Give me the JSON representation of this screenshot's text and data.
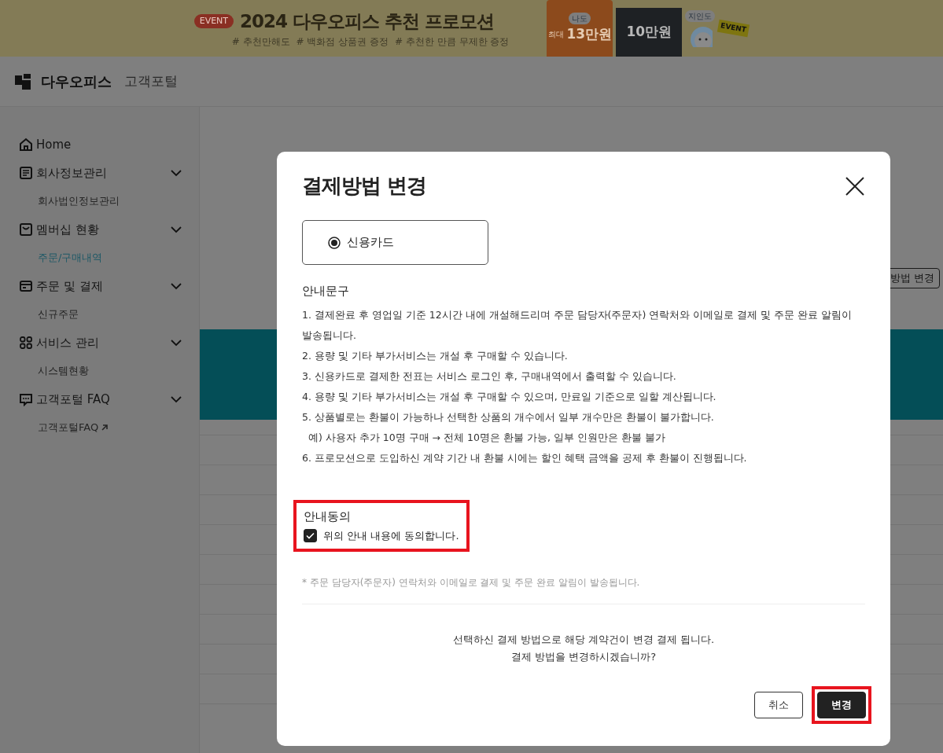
{
  "banner": {
    "badge": "EVENT",
    "title": "2024 다우오피스 추천 프로모션",
    "tags": [
      "# 추천만해도",
      "# 백화점 상품권 증정",
      "# 추천한 만큼 무제한 증정"
    ],
    "promo": {
      "tag_left": "나도",
      "card_left_prefix": "최대",
      "card_left_amount": "13만원",
      "card_right_amount": "10만원",
      "tag_right": "지인도",
      "sign": "EVENT"
    }
  },
  "header": {
    "brand": "다우오피스",
    "portal": "고객포털"
  },
  "sidebar": {
    "items": [
      {
        "label": "Home"
      },
      {
        "label": "회사정보관리",
        "children": [
          {
            "label": "회사법인정보관리",
            "selected": false
          }
        ]
      },
      {
        "label": "멤버십 현황",
        "children": [
          {
            "label": "주문/구매내역",
            "selected": true
          }
        ]
      },
      {
        "label": "주문 및 결제",
        "children": [
          {
            "label": "신규주문",
            "selected": false
          }
        ]
      },
      {
        "label": "서비스 관리",
        "children": [
          {
            "label": "시스템현황",
            "selected": false
          }
        ]
      },
      {
        "label": "고객포털 FAQ",
        "children": [
          {
            "label": "고객포털FAQ",
            "selected": false,
            "external": true
          }
        ]
      }
    ]
  },
  "main": {
    "action_button": "방법 변경"
  },
  "modal": {
    "title": "결제방법 변경",
    "payment_options": [
      {
        "label": "신용카드",
        "selected": true
      }
    ],
    "notice_heading": "안내문구",
    "notice_lines": [
      "1. 결제완료 후 영업일 기준 12시간 내에 개설해드리며 주문 담당자(주문자) 연락처와 이메일로 결제 및 주문 완료 알림이 발송됩니다.",
      "2. 용량 및 기타 부가서비스는 개설 후 구매할 수 있습니다.",
      "3. 신용카드로 결제한 전표는 서비스 로그인 후, 구매내역에서 출력할 수 있습니다.",
      "4. 용량 및 기타 부가서비스는 개설 후 구매할 수 있으며, 만료일 기준으로 일할 계산됩니다.",
      "5. 상품별로는 환불이 가능하나 선택한 상품의 개수에서 일부 개수만은 환불이 불가합니다.",
      "  예) 사용자 추가 10명 구매 → 전체 10명은 환불 가능, 일부 인원만은 환불 불가",
      "6. 프로모션으로 도입하신 계약 기간 내 환불 시에는 할인 혜택 금액을 공제 후 환불이 진행됩니다."
    ],
    "agreement": {
      "heading": "안내동의",
      "label": "위의 안내 내용에 동의합니다.",
      "checked": true,
      "highlighted": true
    },
    "footnote": "* 주문 담당자(주문자) 연락처와 이메일로 결제 및 주문 완료 알림이 발송됩니다.",
    "confirm_lines": [
      "선택하신 결제 방법으로 해당 계약건이 변경 결제 됩니다.",
      "결제 방법을 변경하시겠습니까?"
    ],
    "buttons": [
      {
        "label": "취소",
        "kind": "secondary"
      },
      {
        "label": "변경",
        "kind": "primary",
        "highlighted": true
      }
    ]
  }
}
